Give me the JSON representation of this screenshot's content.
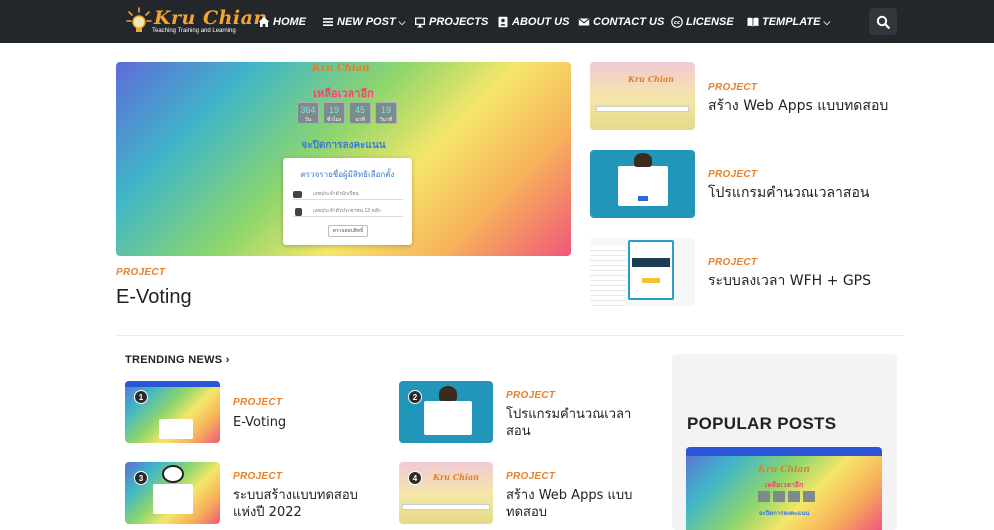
{
  "brand": {
    "logo_title": "Kru Chian",
    "logo_subtitle": "Teaching Training and Learning",
    "accent_color": "#e8812b",
    "nav_bg": "#23262b"
  },
  "nav": {
    "home": "HOME",
    "new_post": "NEW POST",
    "projects": "PROJECTS",
    "about": "ABOUT US",
    "contact": "CONTACT US",
    "license": "LICENSE",
    "template": "TEMPLATE"
  },
  "featured": {
    "label": "PROJECT",
    "title": "E-Voting",
    "preview": {
      "countdown_heading": "เหลือเวลาอีก",
      "counters": [
        {
          "value": "364",
          "unit": "วัน"
        },
        {
          "value": "19",
          "unit": "ชั่วโมง"
        },
        {
          "value": "45",
          "unit": "นาที"
        },
        {
          "value": "19",
          "unit": "วินาที"
        }
      ],
      "closing_text": "จะปิดการลงคะแนน",
      "card_title": "ตรวจรายชื่อผู้มีสิทธิเลือกตั้ง",
      "field_1": "เลขประจำตัวนักเรียน",
      "field_2": "เลขประจำตัวประชาชน 13 หลัก",
      "button": "ตรวจสอบสิทธิ์"
    }
  },
  "side_posts": [
    {
      "label": "PROJECT",
      "title": "สร้าง Web Apps แบบทดสอบ"
    },
    {
      "label": "PROJECT",
      "title": "โปรแกรมคำนวณเวลาสอน"
    },
    {
      "label": "PROJECT",
      "title": "ระบบลงเวลา WFH + GPS"
    }
  ],
  "trending": {
    "heading": "TRENDING NEWS",
    "items": [
      {
        "rank": "1",
        "label": "PROJECT",
        "title": "E-Voting"
      },
      {
        "rank": "2",
        "label": "PROJECT",
        "title_line1": "โปรแกรมคำนวณเวลา",
        "title_line2": "สอน"
      },
      {
        "rank": "3",
        "label": "PROJECT",
        "title_line1": "ระบบสร้างแบบทดสอบ",
        "title_line2": "แห่งปี 2022"
      },
      {
        "rank": "4",
        "label": "PROJECT",
        "title_line1": "สร้าง Web Apps แบบ",
        "title_line2": "ทดสอบ"
      }
    ]
  },
  "popular": {
    "heading": "POPULAR POSTS"
  },
  "icons": {
    "home": "home-icon",
    "menu": "menu-icon",
    "projects": "projector-icon",
    "about": "user-tie-icon",
    "contact": "envelope-icon",
    "license": "creative-commons-icon",
    "template": "book-icon",
    "search": "search-icon"
  }
}
